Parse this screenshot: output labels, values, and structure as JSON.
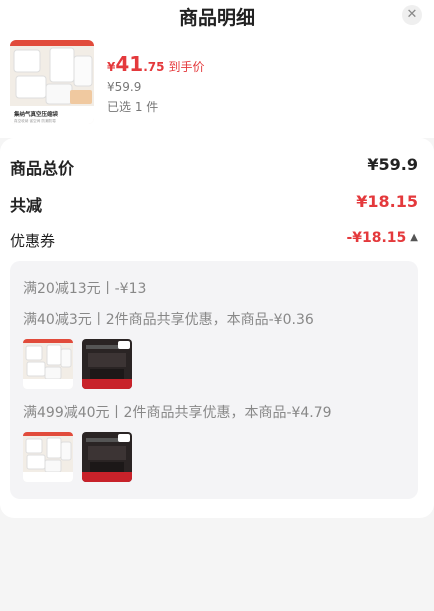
{
  "header": {
    "title": "商品明细",
    "close_symbol": "✕"
  },
  "product": {
    "image_caption": "集纳气真空压缩袋",
    "image_subcaption": "真空收纳 省空间 防潮防霉",
    "price_yen": "¥",
    "price_int": "41",
    "price_dec": ".75",
    "price_label": "到手价",
    "original_price": "¥59.9",
    "selected_count": "已选 1 件"
  },
  "summary": {
    "total": {
      "label": "商品总价",
      "value": "¥59.9"
    },
    "discount": {
      "label": "共减",
      "value": "¥18.15"
    },
    "coupon": {
      "label": "优惠券",
      "value": "-¥18.15"
    }
  },
  "coupons": [
    {
      "text": "满20减13元丨-¥13"
    },
    {
      "text": "满40减3元丨2件商品共享优惠，本商品-¥0.36"
    },
    {
      "text": "满499减40元丨2件商品共享优惠，本商品-¥4.79"
    }
  ],
  "colors": {
    "accent": "#e4393c",
    "text": "#222222",
    "muted": "#888888",
    "panel": "#f4f4f6"
  }
}
